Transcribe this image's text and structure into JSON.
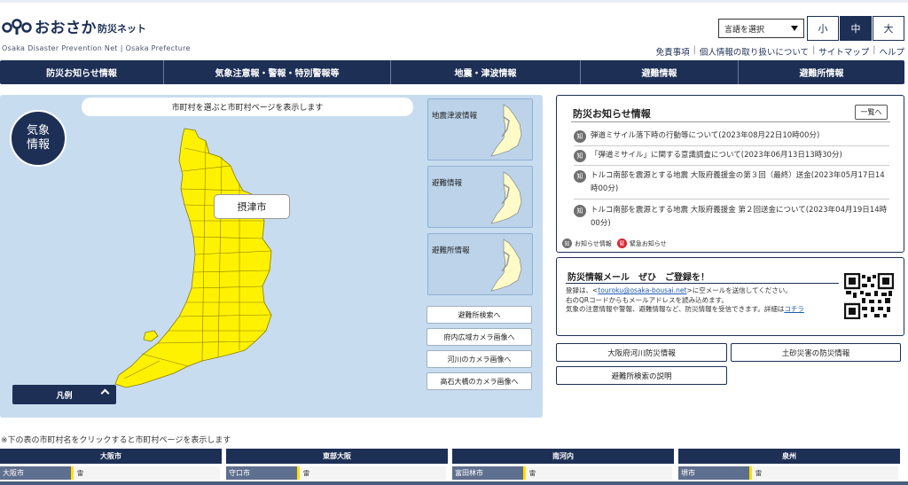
{
  "header": {
    "logo_title": "おおさか",
    "logo_subtitle": "防災ネット",
    "logo_english": "Osaka Disaster Prevention Net | Osaka Prefecture",
    "language_select": "言語を選択",
    "font_sizes": [
      "小",
      "中",
      "大"
    ],
    "active_font_size": "中",
    "util_links": [
      "免責事項",
      "個人情報の取り扱いについて",
      "サイトマップ",
      "ヘルプ"
    ]
  },
  "nav": {
    "items": [
      "防災お知らせ情報",
      "気象注意報・警報・特別警報等",
      "地震・津波情報",
      "避難情報",
      "避難所情報"
    ]
  },
  "map": {
    "banner": "市町村を選ぶと市町村ページを表示します",
    "badge_line1": "気象",
    "badge_line2": "情報",
    "hovered_city": "摂津市",
    "legend_label": "凡例",
    "thumbnails": [
      "地震津波情報",
      "避難情報",
      "避難所情報"
    ],
    "side_buttons": [
      "避難所検索へ",
      "府内広域カメラ画像へ",
      "河川のカメラ画像へ",
      "高石大橋のカメラ画像へ"
    ],
    "fill_color": "#fff200"
  },
  "info": {
    "title": "防災お知らせ情報",
    "list_button": "一覧へ",
    "badge_text": "知",
    "items": [
      "弾道ミサイル落下時の行動等について(2023年08月22日10時00分)",
      "「弾道ミサイル」に関する意識調査について(2023年06月13日13時30分)",
      "トルコ南部を震源とする地震 大阪府義援金の第３回（最終）送金(2023年05月17日14時00分)",
      "トルコ南部を震源とする地震 大阪府義援金 第２回送金について(2023年04月19日14時00分)"
    ],
    "legend_info": "お知らせ情報",
    "legend_urgent_badge": "緊",
    "legend_urgent": "緊急お知らせ"
  },
  "mail": {
    "title": "防災情報メール　ぜひ　ご登録を！",
    "text_before": "登録は、<",
    "email": "touroku@osaka-bousai.net",
    "text_after": ">に空メールを送信してください。",
    "line2": "右のQRコードからもメールアドレスを読み込めます。",
    "line3": "気象の注意情報や警報、避難情報など、防災情報を受信できます。詳細は",
    "link_text": "コチラ"
  },
  "links": {
    "river": "大阪府河川防災情報",
    "landslide": "土砂災害の防災情報",
    "shelter_help": "避難所検索の説明"
  },
  "bottom": {
    "note": "※下の表の市町村名をクリックすると市町村ページを表示します",
    "regions": [
      "大阪市",
      "東部大阪",
      "南河内",
      "泉州"
    ],
    "rows": [
      {
        "muni": "大阪市",
        "warn": "雷"
      },
      {
        "muni": "守口市",
        "warn": "雷"
      },
      {
        "muni": "富田林市",
        "warn": "雷"
      },
      {
        "muni": "堺市",
        "warn": "雷"
      }
    ]
  }
}
